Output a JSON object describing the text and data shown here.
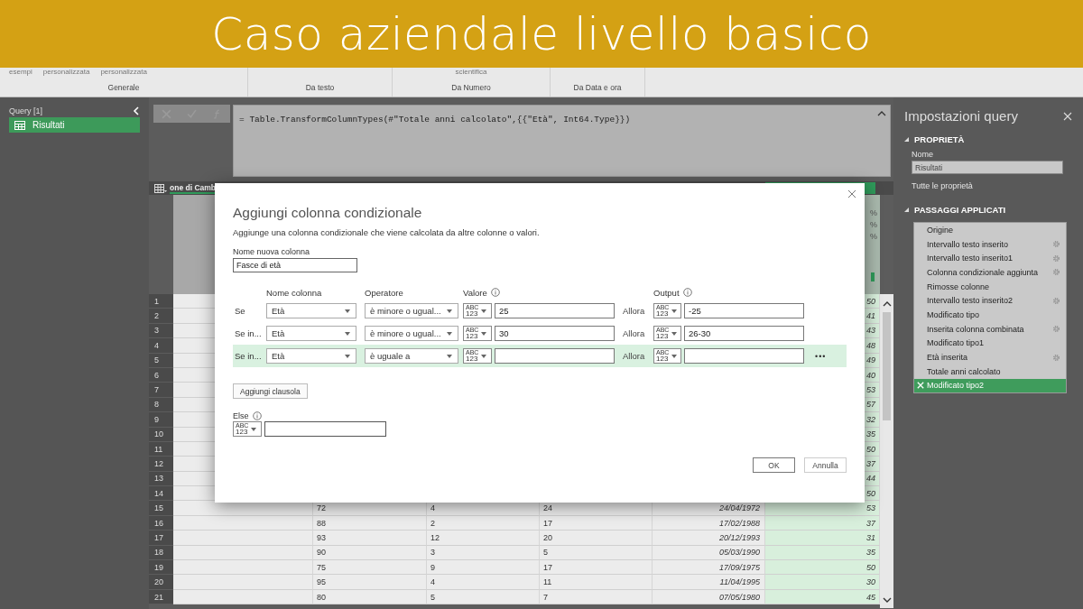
{
  "banner": {
    "title": "Caso aziendale livello basico"
  },
  "ribbon": {
    "groups": [
      {
        "label": "Generale",
        "cut_items": [
          "esempi",
          "personalizzata",
          "personalizzata"
        ]
      },
      {
        "label": "Da testo"
      },
      {
        "label": "Da Numero",
        "cut_items": [
          "scientifica"
        ]
      },
      {
        "label": "Da Data e ora"
      }
    ]
  },
  "queries": {
    "title": "Query [1]",
    "items": [
      {
        "label": "Risultati",
        "selected": true
      }
    ]
  },
  "formula": {
    "text": "= Table.TransformColumnTypes(#\"Totale anni calcolato\",{{\"Età\", Int64.Type}})"
  },
  "table": {
    "header": "one di Camb",
    "quality": [
      "%",
      "%",
      "%"
    ],
    "rows": [
      {
        "number": "1",
        "column_7": "50"
      },
      {
        "number": "2",
        "column_7": "41"
      },
      {
        "number": "3",
        "column_7": "43"
      },
      {
        "number": "4",
        "column_7": "48"
      },
      {
        "number": "5",
        "column_7": "49"
      },
      {
        "number": "6",
        "column_7": "40"
      },
      {
        "number": "7",
        "column_7": "53"
      },
      {
        "number": "8",
        "column_7": "57"
      },
      {
        "number": "9",
        "column_7": "32"
      },
      {
        "number": "10",
        "column_7": "35"
      },
      {
        "number": "11",
        "column_7": "50"
      },
      {
        "number": "12",
        "column_7": "37"
      },
      {
        "number": "13",
        "column_7": "44"
      },
      {
        "number": "14",
        "column_7": "50"
      },
      {
        "number": "15",
        "column_3": "72",
        "column_4": "4",
        "column_5": "24",
        "column_6": "24/04/1972",
        "column_7": "53"
      },
      {
        "number": "16",
        "column_3": "88",
        "column_4": "2",
        "column_5": "17",
        "column_6": "17/02/1988",
        "column_7": "37"
      },
      {
        "number": "17",
        "column_3": "93",
        "column_4": "12",
        "column_5": "20",
        "column_6": "20/12/1993",
        "column_7": "31"
      },
      {
        "number": "18",
        "column_3": "90",
        "column_4": "3",
        "column_5": "5",
        "column_6": "05/03/1990",
        "column_7": "35"
      },
      {
        "number": "19",
        "column_3": "75",
        "column_4": "9",
        "column_5": "17",
        "column_6": "17/09/1975",
        "column_7": "50"
      },
      {
        "number": "20",
        "column_3": "95",
        "column_4": "4",
        "column_5": "11",
        "column_6": "11/04/1995",
        "column_7": "30"
      },
      {
        "number": "21",
        "column_3": "80",
        "column_4": "5",
        "column_5": "7",
        "column_6": "07/05/1980",
        "column_7": "45"
      }
    ]
  },
  "dialog": {
    "title": "Aggiungi colonna condizionale",
    "description": "Aggiunge una colonna condizionale che viene calcolata da altre colonne o valori.",
    "name_label": "Nome nuova colonna",
    "name_value": "Fasce di età",
    "headers": {
      "column": "Nome colonna",
      "operator": "Operatore",
      "value": "Valore",
      "output": "Output"
    },
    "conditions": [
      {
        "prefix": "Se",
        "column": "Età",
        "operator": "è minore o ugual...",
        "value_type": [
          "ABC",
          "123"
        ],
        "value": "25",
        "then": "Allora",
        "output_type": [
          "ABC",
          "123"
        ],
        "output": "-25",
        "selected": false
      },
      {
        "prefix": "Se in...",
        "column": "Età",
        "operator": "è minore o ugual...",
        "value_type": [
          "ABC",
          "123"
        ],
        "value": "30",
        "then": "Allora",
        "output_type": [
          "ABC",
          "123"
        ],
        "output": "26-30",
        "selected": false
      },
      {
        "prefix": "Se in...",
        "column": "Età",
        "operator": "è uguale a",
        "value_type": [
          "ABC",
          "123"
        ],
        "then": "Allora",
        "output_type": [
          "ABC",
          "123"
        ],
        "selected": true,
        "more": "•••"
      }
    ],
    "add_clause": "Aggiungi clausola",
    "else_label": "Else",
    "else_type": [
      "ABC",
      "123"
    ],
    "ok": "OK",
    "cancel": "Annulla"
  },
  "settings": {
    "title": "Impostazioni query",
    "properties_heading": "PROPRIETÀ",
    "name_label": "Nome",
    "name_value": "Risultati",
    "all_properties": "Tutte le proprietà",
    "steps_heading": "PASSAGGI APPLICATI",
    "steps": [
      {
        "label": "Origine",
        "has_settings": false,
        "selected": false
      },
      {
        "label": "Intervallo testo inserito",
        "has_settings": true,
        "selected": false
      },
      {
        "label": "Intervallo testo inserito1",
        "has_settings": true,
        "selected": false
      },
      {
        "label": "Colonna condizionale aggiunta",
        "has_settings": true,
        "selected": false
      },
      {
        "label": "Rimosse colonne",
        "has_settings": false,
        "selected": false
      },
      {
        "label": "Intervallo testo inserito2",
        "has_settings": true,
        "selected": false
      },
      {
        "label": "Modificato tipo",
        "has_settings": false,
        "selected": false
      },
      {
        "label": "Inserita colonna combinata",
        "has_settings": true,
        "selected": false
      },
      {
        "label": "Modificato tipo1",
        "has_settings": false,
        "selected": false
      },
      {
        "label": "Età inserita",
        "has_settings": true,
        "selected": false
      },
      {
        "label": "Totale anni calcolato",
        "has_settings": false,
        "selected": false
      },
      {
        "label": "Modificato tipo2",
        "has_settings": false,
        "selected": true
      }
    ]
  }
}
